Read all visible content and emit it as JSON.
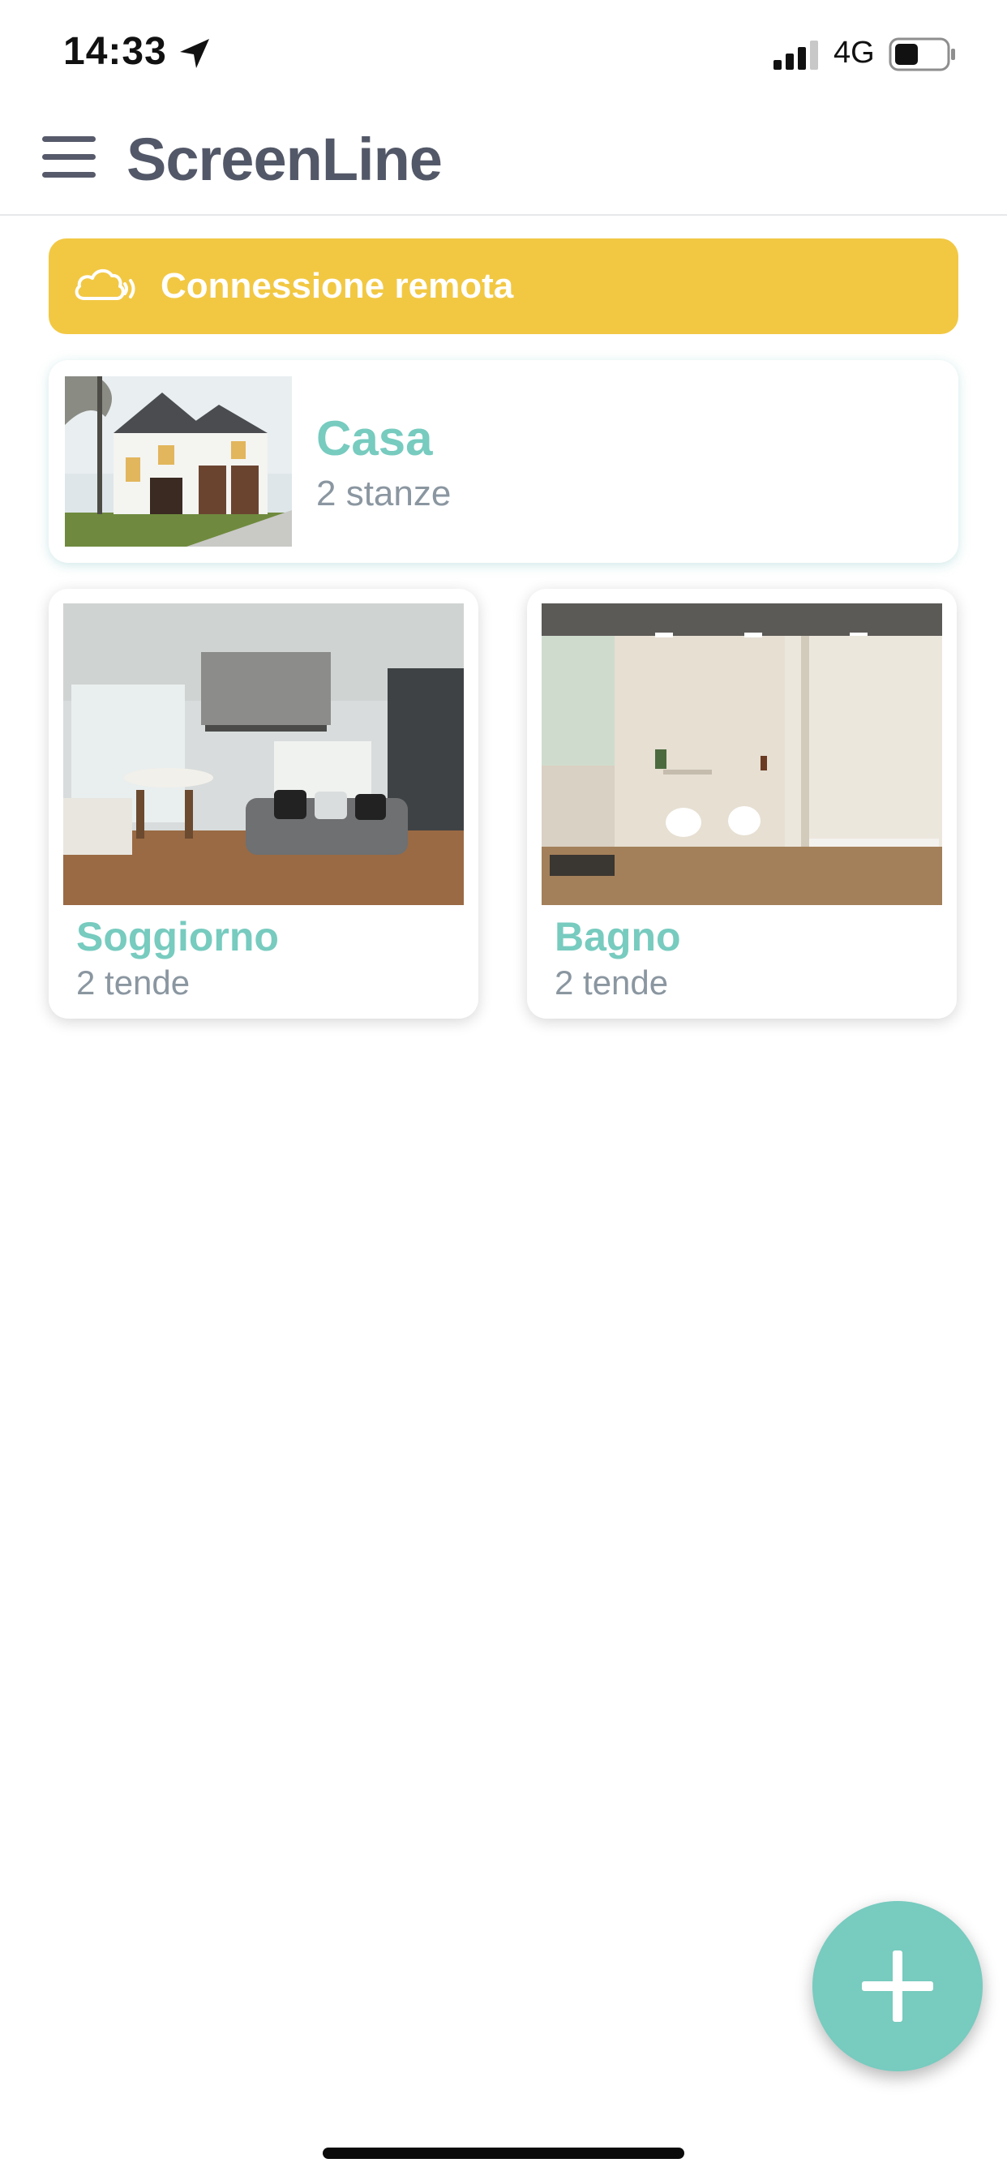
{
  "status_bar": {
    "time": "14:33",
    "network": "4G",
    "battery_percent": 40
  },
  "header": {
    "title": "ScreenLine",
    "menu_icon": "hamburger-menu-icon"
  },
  "banner": {
    "label": "Connessione remota",
    "icon": "cloud-signal-icon",
    "color": "#f2c843"
  },
  "home": {
    "name": "Casa",
    "subtitle": "2 stanze"
  },
  "rooms": [
    {
      "name": "Soggiorno",
      "subtitle": "2 tende"
    },
    {
      "name": "Bagno",
      "subtitle": "2 tende"
    }
  ],
  "fab": {
    "icon": "plus-icon"
  },
  "colors": {
    "accent": "#77cbbf",
    "banner": "#f2c843",
    "title": "#535868",
    "subtitle": "#8a96a0"
  }
}
